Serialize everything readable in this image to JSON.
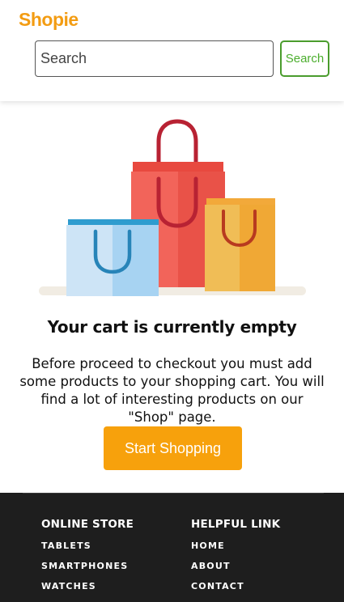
{
  "header": {
    "logo": "Shopie",
    "search": {
      "placeholder": "Search",
      "value": ""
    },
    "search_button_label": "Search"
  },
  "cart": {
    "title": "Your cart is currently empty",
    "description": "Before proceed to checkout you must add some products to your shopping cart. You will find a lot of interesting products on our \"Shop\" page.",
    "start_button_label": "Start Shopping"
  },
  "footer": {
    "online_store": {
      "heading": "ONLINE STORE",
      "links": [
        "TABLETS",
        "SMARTPHONES",
        "WATCHES"
      ]
    },
    "helpful_link": {
      "heading": "HELPFUL LINK",
      "links": [
        "HOME",
        "ABOUT",
        "CONTACT"
      ]
    }
  },
  "colors": {
    "brand": "#f39c12",
    "accent_button": "#f7a10c",
    "search_button": "#4cae2e",
    "footer_bg": "#1e1e1e"
  },
  "icons": [
    "shopping-bags-illustration"
  ]
}
